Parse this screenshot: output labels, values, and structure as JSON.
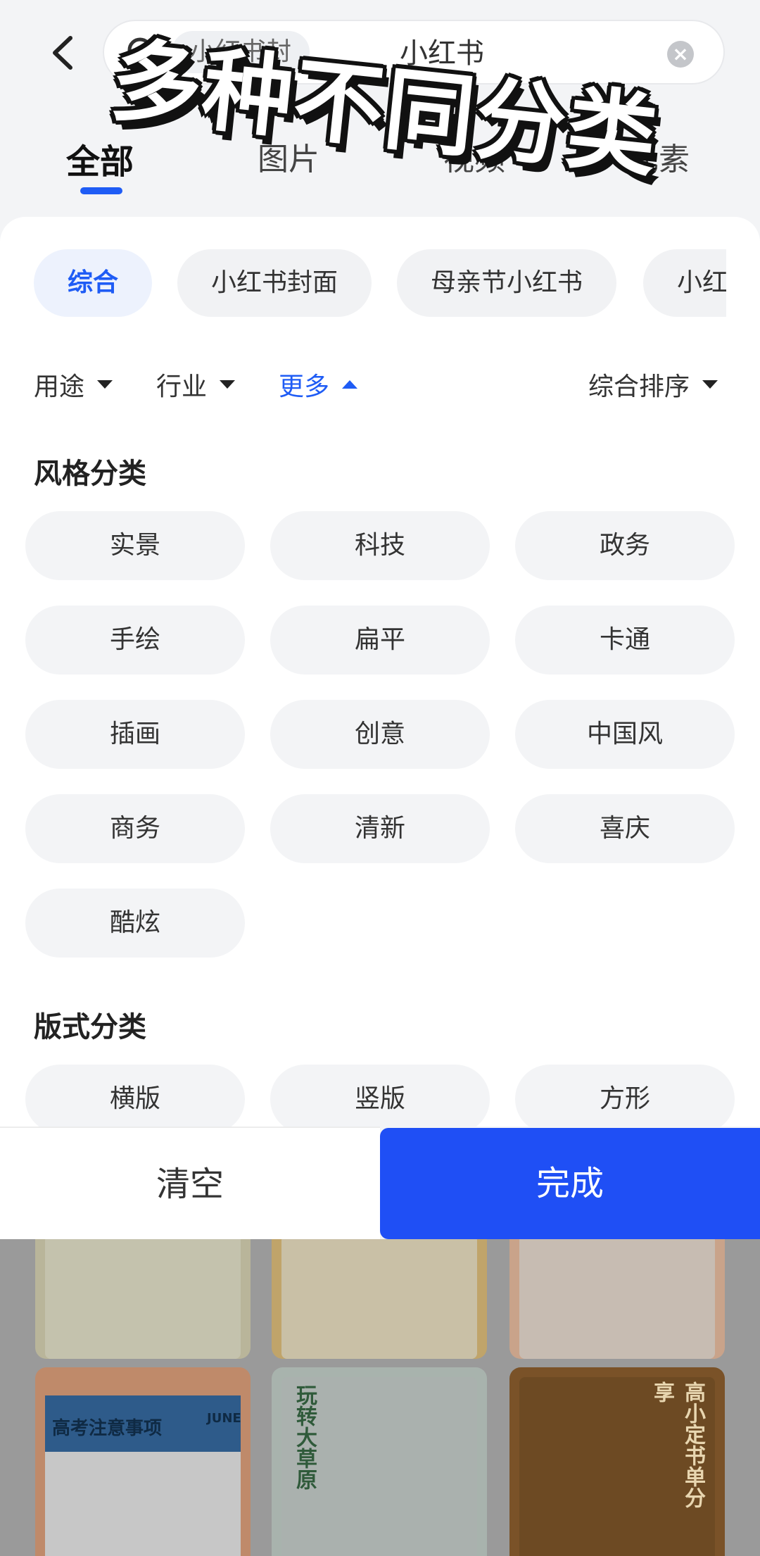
{
  "header": {
    "search_tag": "小红书封",
    "search_text": "小红书",
    "overlay_title": "多种不同分类"
  },
  "tabs": [
    {
      "label": "全部",
      "active": true
    },
    {
      "label": "图片",
      "active": false
    },
    {
      "label": "视频",
      "active": false
    },
    {
      "label": "元素",
      "active": false
    }
  ],
  "chips": [
    {
      "label": "综合",
      "active": true
    },
    {
      "label": "小红书封面",
      "active": false
    },
    {
      "label": "母亲节小红书",
      "active": false
    },
    {
      "label": "小红",
      "active": false
    }
  ],
  "filters": {
    "usage": "用途",
    "industry": "行业",
    "more": "更多",
    "sort": "综合排序"
  },
  "style_section": {
    "title": "风格分类",
    "options": [
      "实景",
      "科技",
      "政务",
      "手绘",
      "扁平",
      "卡通",
      "插画",
      "创意",
      "中国风",
      "商务",
      "清新",
      "喜庆",
      "酷炫"
    ]
  },
  "layout_section": {
    "title": "版式分类",
    "options": [
      "横版",
      "竖版",
      "方形"
    ]
  },
  "buttons": {
    "clear": "清空",
    "done": "完成"
  },
  "background_cards": {
    "card4_title": "高考注意事项",
    "card4_tag": "JUNE",
    "card5_title": "玩转大草原",
    "card6_title": "高小定书单分享"
  },
  "colors": {
    "accent": "#1f5cf5",
    "done_button": "#1f4ff5"
  }
}
